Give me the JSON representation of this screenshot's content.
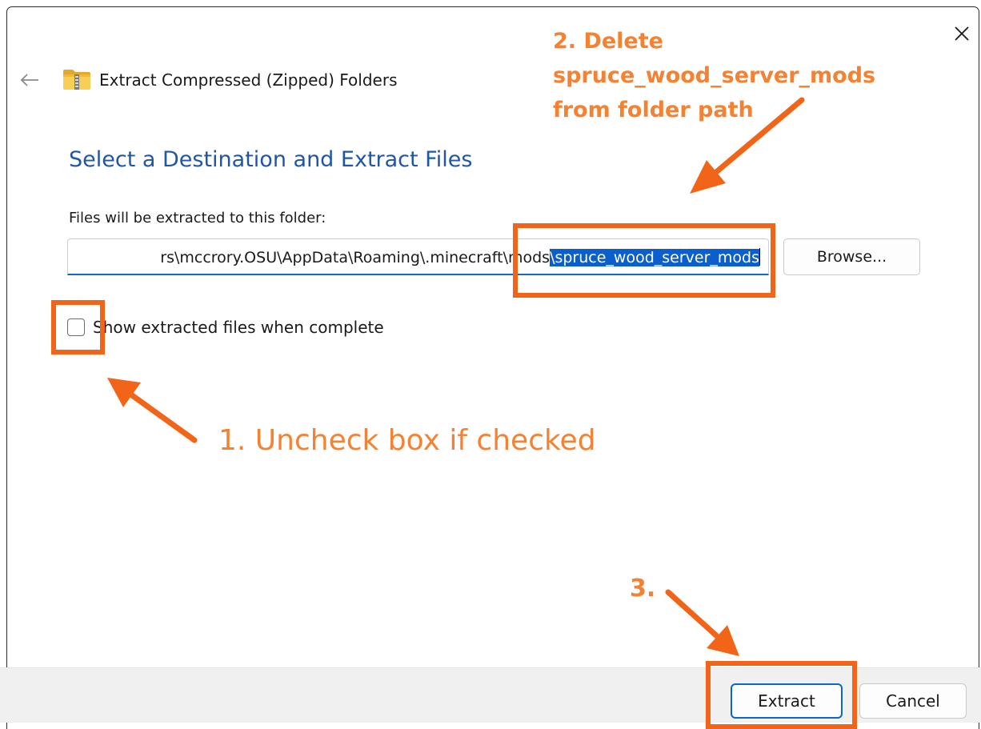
{
  "window": {
    "title": "Extract Compressed (Zipped) Folders",
    "heading": "Select a Destination and Extract Files",
    "back_icon": "arrow-left-icon",
    "close_icon": "close-icon",
    "folder_icon": "zip-folder-icon"
  },
  "destination": {
    "label": "Files will be extracted to this folder:",
    "path_unselected": "rs\\mccrory.OSU\\AppData\\Roaming\\.minecraft\\mods",
    "path_selected": "\\spruce_wood_server_mods",
    "browse_label": "Browse..."
  },
  "options": {
    "show_files_label": "Show extracted files when complete",
    "show_files_checked": false
  },
  "footer": {
    "extract_label": "Extract",
    "cancel_label": "Cancel"
  },
  "annotations": {
    "step1": "1. Uncheck box if checked",
    "step2_line1": "2. Delete",
    "step2_line2": "spruce_wood_server_mods",
    "step2_line3": "from folder path",
    "step3": "3.",
    "color": "#f26418"
  },
  "colors": {
    "accent": "#0e66c6",
    "heading": "#1f56a8",
    "selection": "#0b5fcc"
  }
}
